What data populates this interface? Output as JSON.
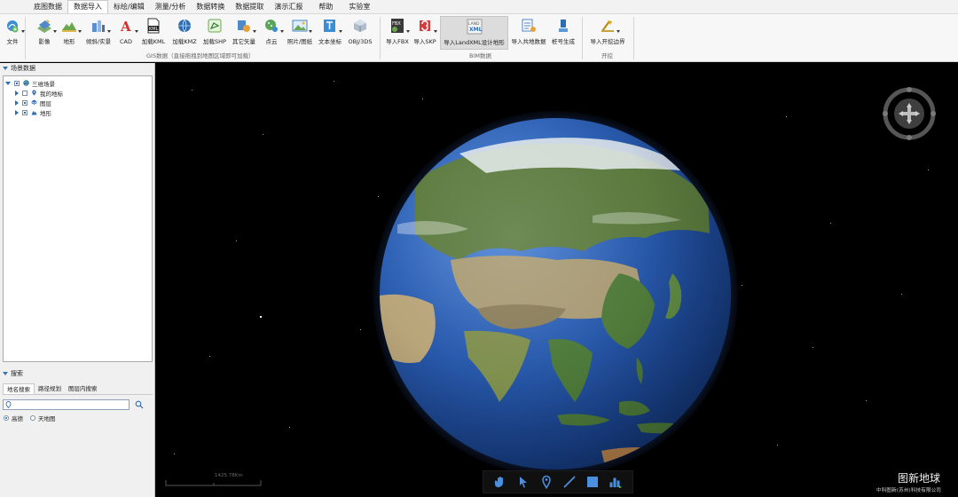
{
  "menu": {
    "items": [
      "底图数据",
      "数据导入",
      "标绘/编辑",
      "测量/分析",
      "数据转换",
      "数据提取",
      "演示汇报",
      "帮助",
      "实验室"
    ],
    "active_index": 1
  },
  "ribbon": {
    "file": "文件",
    "gis_buttons": [
      "影像",
      "地形",
      "倾斜/实景",
      "CAD",
      "加载KML",
      "加载KMZ",
      "加载SHP",
      "其它矢量",
      "点云",
      "照片/图纸",
      "文本坐标",
      "OBJ/3DS"
    ],
    "gis_group": "GIS数据（直接拖拽到地图区域即可加载）",
    "bim_buttons": [
      "导入FBX",
      "导入SKP",
      "导入LandXML设计地形",
      "导入共地数据",
      "桩号生成"
    ],
    "bim_group": "BIM数据",
    "excavation_button": "导入开挖边界",
    "excavation_group": "开挖",
    "icon_labels": {
      "kml": "KML",
      "xml": "XML",
      "land": "LAND",
      "fbx": "FBX",
      "cad": "A"
    }
  },
  "scene": {
    "title": "场景数据",
    "tree": {
      "root": "三维场景",
      "children": [
        "我的地标",
        "图层",
        "地形"
      ]
    }
  },
  "search": {
    "title": "搜索",
    "tabs": [
      "地名搜索",
      "路径规划",
      "图层内搜索"
    ],
    "input_value": "",
    "radio_options": [
      "高德",
      "天地图"
    ],
    "selected_radio": 0
  },
  "viewport": {
    "scale_label": "1425.78Km",
    "brand": "图新地球",
    "brand_sub": "中科图新(苏州)科技有限公司"
  },
  "colors": {
    "ocean": "#2c5fb3",
    "land": "#5b7a3e",
    "desert": "#a89a74",
    "snow": "#e8ecef",
    "accent_blue": "#2f6db3"
  },
  "icons": [
    "file-icon",
    "imagery-icon",
    "terrain-icon",
    "oblique-icon",
    "cad-icon",
    "kml-icon",
    "kmz-icon",
    "shp-icon",
    "vector-icon",
    "pointcloud-icon",
    "photo-icon",
    "text-coord-icon",
    "obj-icon",
    "fbx-icon",
    "skp-icon",
    "landxml-icon",
    "shared-data-icon",
    "stake-icon",
    "excavation-icon",
    "pan-hand-icon",
    "pointer-icon",
    "placemark-icon",
    "line-icon",
    "polygon-icon",
    "profile-icon"
  ]
}
